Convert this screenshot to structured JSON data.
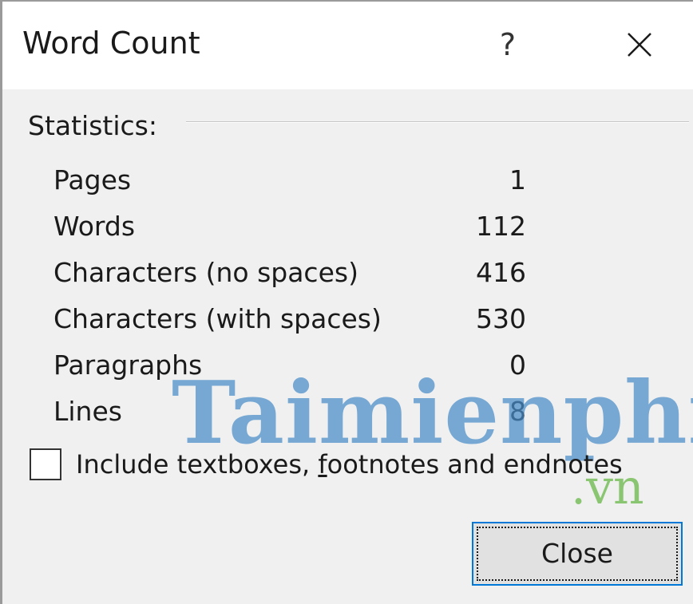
{
  "dialog": {
    "title": "Word Count",
    "help_glyph": "?",
    "close_glyph": "close-x-icon"
  },
  "statistics": {
    "header": "Statistics:",
    "rows": [
      {
        "label": "Pages",
        "value": "1"
      },
      {
        "label": "Words",
        "value": "112"
      },
      {
        "label": "Characters (no spaces)",
        "value": "416"
      },
      {
        "label": "Characters (with spaces)",
        "value": "530"
      },
      {
        "label": "Paragraphs",
        "value": "0"
      },
      {
        "label": "Lines",
        "value": "8"
      }
    ]
  },
  "options": {
    "include_label_before": "Include textboxes, ",
    "include_label_accel": "f",
    "include_label_after": "ootnotes and endnotes",
    "include_checked": false
  },
  "buttons": {
    "close_label": "Close"
  },
  "watermark": {
    "main": "Taimienphi",
    "sub": ".vn"
  },
  "colors": {
    "focus_border": "#0078d7",
    "watermark_blue": "#468cc8",
    "watermark_green": "#78be5a"
  }
}
